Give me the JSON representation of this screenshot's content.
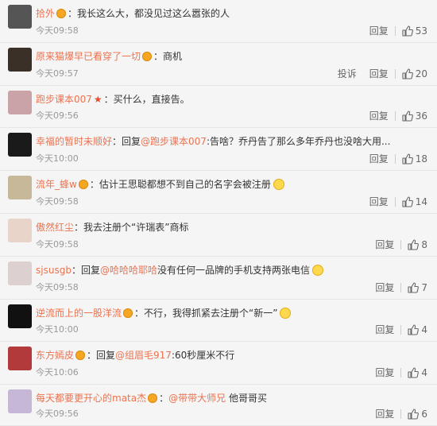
{
  "comments": [
    {
      "name": "拾外",
      "badge": true,
      "star": false,
      "reply_to": "",
      "text": "：我长这么大，都没见过这么嚣张的人",
      "emoji": false,
      "time": "今天09:58",
      "report": "",
      "reply_label": "回复",
      "likes": "53",
      "avatar_color": "#555555"
    },
    {
      "name": "原来猫爆早已看穿了一切",
      "badge": true,
      "star": false,
      "reply_to": "",
      "text": "：商机",
      "emoji": false,
      "time": "今天09:57",
      "report": "投诉",
      "reply_label": "回复",
      "likes": "20",
      "avatar_color": "#3a3028"
    },
    {
      "name": "跑步课本007",
      "badge": false,
      "star": true,
      "reply_to": "",
      "text": "：买什么，直接告。",
      "emoji": false,
      "time": "今天09:56",
      "report": "",
      "reply_label": "回复",
      "likes": "36",
      "avatar_color": "#c9a3a8"
    },
    {
      "name": "幸福的暂时未顺好",
      "badge": false,
      "star": false,
      "reply_to": "@跑步课本007",
      "text": ":告啥？乔丹告了那么多年乔丹也没啥大用...",
      "reply_prefix": "：回复",
      "emoji": false,
      "time": "今天10:00",
      "report": "",
      "reply_label": "回复",
      "likes": "18",
      "avatar_color": "#1a1a1a"
    },
    {
      "name": "流年_蜂w",
      "badge": true,
      "star": false,
      "reply_to": "",
      "text": "：估计王思聪都想不到自己的名字会被注册",
      "emoji": true,
      "time": "今天09:58",
      "report": "",
      "reply_label": "回复",
      "likes": "14",
      "avatar_color": "#c8b89a"
    },
    {
      "name": "傲然红尘",
      "badge": false,
      "star": false,
      "reply_to": "",
      "text": "：我去注册个“许瑞表”商标",
      "emoji": false,
      "time": "今天09:58",
      "report": "",
      "reply_label": "回复",
      "likes": "8",
      "avatar_color": "#e8d4c8"
    },
    {
      "name": "sjsusgb",
      "badge": false,
      "star": false,
      "reply_to": "@哈哈哈耶哈",
      "text": "没有任何一品牌的手机支持两张电信",
      "reply_prefix": "：回复",
      "emoji": true,
      "time": "今天09:58",
      "report": "",
      "reply_label": "回复",
      "likes": "7",
      "avatar_color": "#ddd0d0"
    },
    {
      "name": "逆流而上的一股洋流",
      "badge": true,
      "star": false,
      "reply_to": "",
      "text": "：不行，我得抓紧去注册个“新一”",
      "emoji": true,
      "time": "今天10:00",
      "report": "",
      "reply_label": "回复",
      "likes": "4",
      "avatar_color": "#111111"
    },
    {
      "name": "东方嫣皮",
      "badge": true,
      "star": false,
      "reply_to": "@组眉毛917",
      "text": ":60秒厘米不行",
      "reply_prefix": "：回复",
      "emoji": false,
      "time": "今天10:06",
      "report": "",
      "reply_label": "回复",
      "likes": "4",
      "avatar_color": "#b23a3a"
    },
    {
      "name": "每天都要更开心的mata杰",
      "badge": true,
      "star": false,
      "reply_to": "@带带大师兄",
      "text": " 他哥哥买",
      "reply_prefix": "：",
      "emoji": false,
      "time": "今天09:56",
      "report": "",
      "reply_label": "回复",
      "likes": "6",
      "avatar_color": "#c7b7d6"
    }
  ]
}
